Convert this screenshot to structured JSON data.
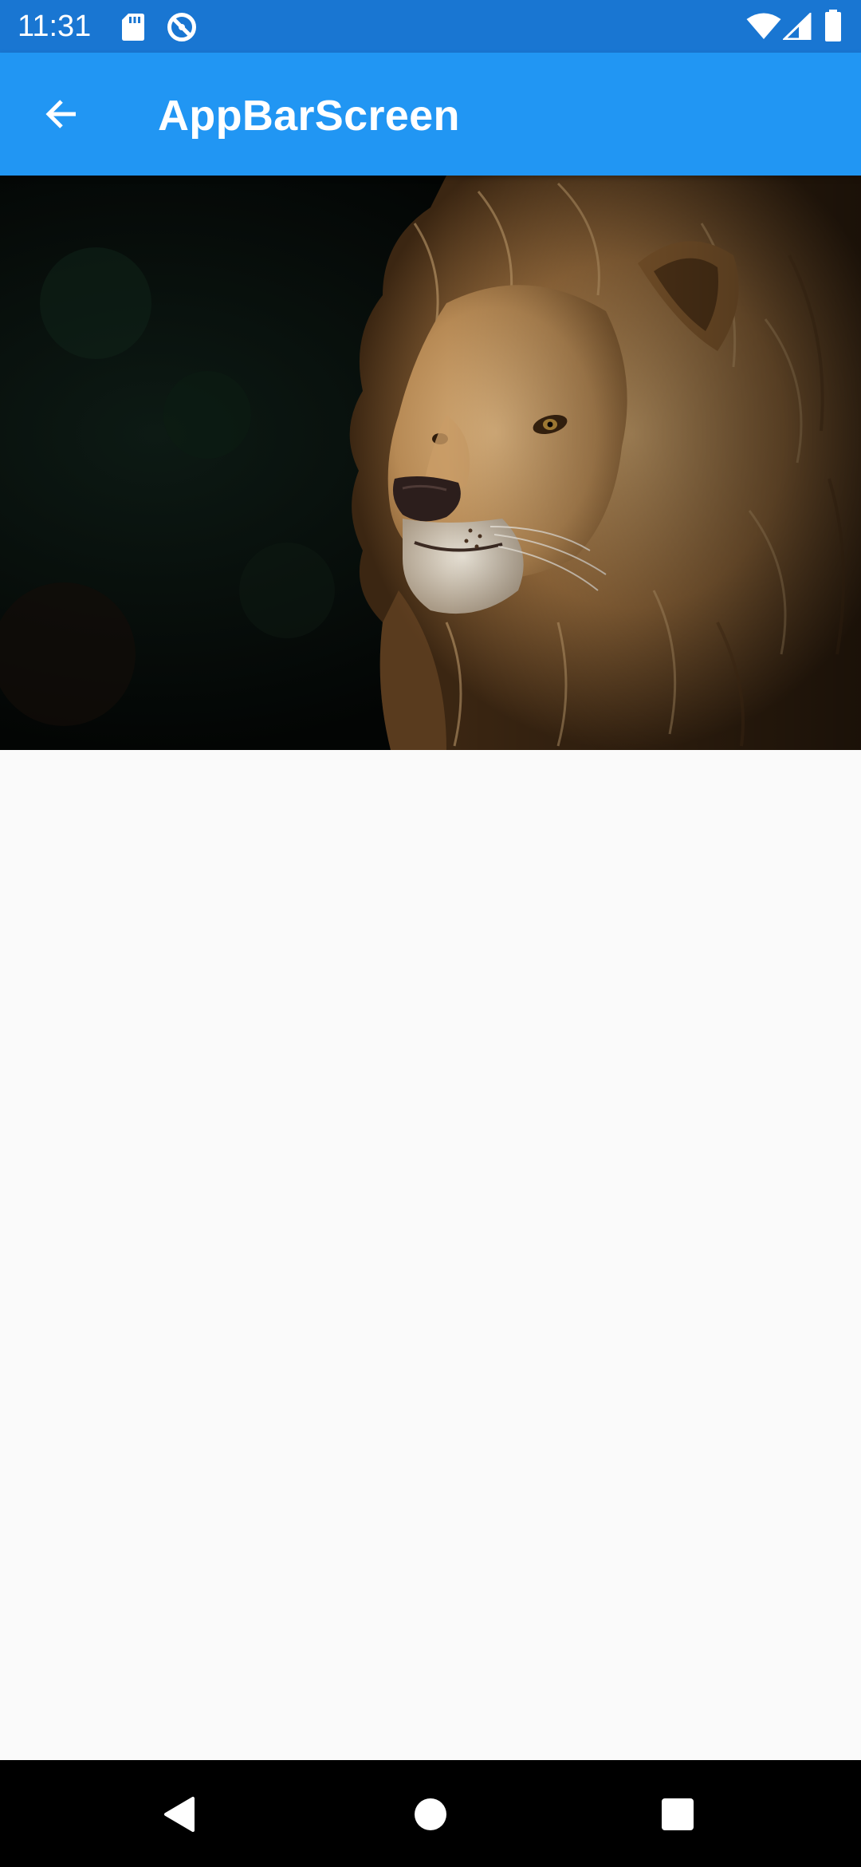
{
  "status_bar": {
    "time": "11:31",
    "background": "#1976d2",
    "icons": [
      "sd-card-icon",
      "no-disturb-icon",
      "wifi-icon",
      "cellular-signal-icon",
      "battery-icon"
    ]
  },
  "app_bar": {
    "title": "AppBarScreen",
    "background": "#2196f3",
    "back_icon": "arrow-back-icon"
  },
  "hero_image": {
    "subject": "lion",
    "icon": "lion-photo"
  },
  "navigation_bar": {
    "background": "#000000",
    "buttons": [
      "back-triangle-icon",
      "home-circle-icon",
      "recents-square-icon"
    ]
  }
}
